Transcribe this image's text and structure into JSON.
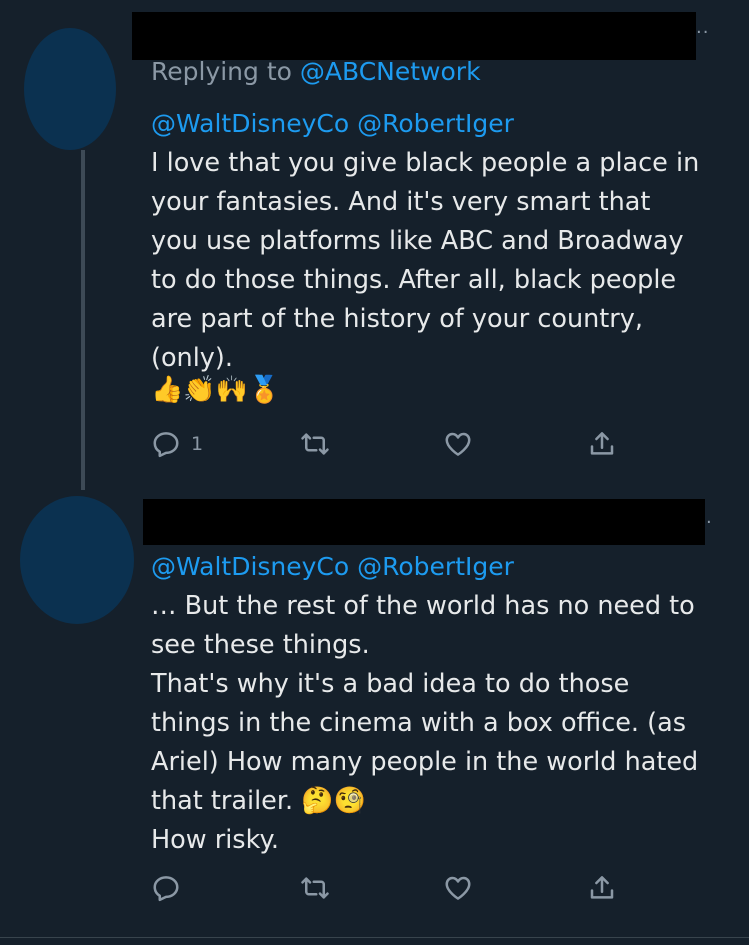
{
  "tweet1": {
    "replying_prefix": "Replying to ",
    "replying_handle": "@ABCNetwork",
    "mention_a": "@WaltDisneyCo",
    "mention_b": "@RobertIger",
    "text": "I love that you give black people a place in\nyour fantasies. And it's very smart that\nyou use platforms like ABC and Broadway\nto do those things. After all, black people\nare part of the history of your country,\n(only).",
    "emojis": [
      "👍",
      "👏",
      "🙌",
      "🏅"
    ],
    "more_label": "··",
    "reply_count": "1"
  },
  "tweet2": {
    "mention_a": "@WaltDisneyCo",
    "mention_b": "@RobertIger",
    "text_lines": [
      "… But the rest of the world has no need to",
      "see these things.",
      "That's why it's a bad idea to do those",
      "things in the cinema with a box office. (as",
      "Ariel) How many people in the world hated",
      "that trailer."
    ],
    "emojis": [
      "🤔",
      "🧐"
    ],
    "closing": "How risky.",
    "more_label": "·"
  },
  "icons": {
    "reply": "reply-icon",
    "retweet": "retweet-icon",
    "like": "heart-icon",
    "share": "share-icon"
  },
  "colors": {
    "background": "#15202b",
    "text": "#e7e9ea",
    "muted": "#8b98a5",
    "link": "#1d9bf0",
    "avatar": "#0b3150"
  }
}
